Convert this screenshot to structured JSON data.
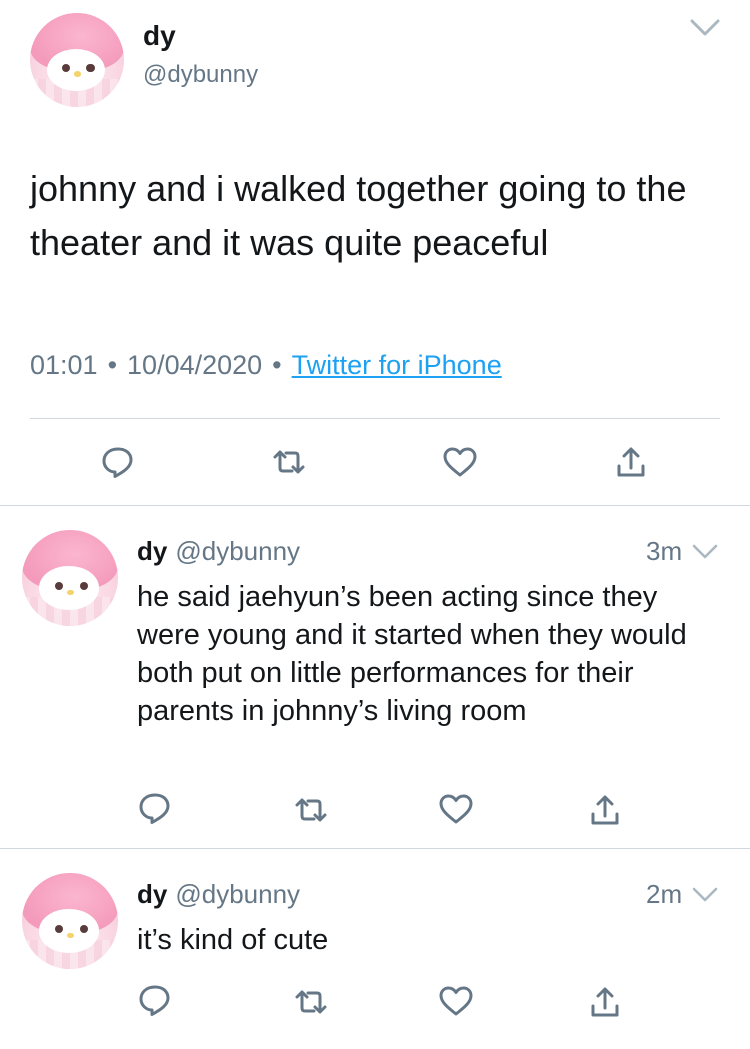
{
  "main_tweet": {
    "name": "dy",
    "handle": "@dybunny",
    "text": "johnny and i walked together going to the theater and it was quite peaceful",
    "time": "01:01",
    "date": "10/04/2020",
    "source": "Twitter for iPhone",
    "separator": "•"
  },
  "replies": [
    {
      "name": "dy",
      "handle": "@dybunny",
      "time": "3m",
      "text": "he said jaehyun’s been acting since they were young and it started when they would both put on little performances for their parents in johnny’s living room"
    },
    {
      "name": "dy",
      "handle": "@dybunny",
      "time": "2m",
      "text": "it’s kind of cute"
    }
  ],
  "icons": {
    "reply": "reply-icon",
    "retweet": "retweet-icon",
    "like": "heart-icon",
    "share": "share-icon",
    "menu": "chevron-down-icon"
  },
  "colors": {
    "text": "#14171a",
    "secondary": "#657786",
    "link": "#1da1f2",
    "icon": "#657786",
    "divider": "#d0d7de"
  }
}
